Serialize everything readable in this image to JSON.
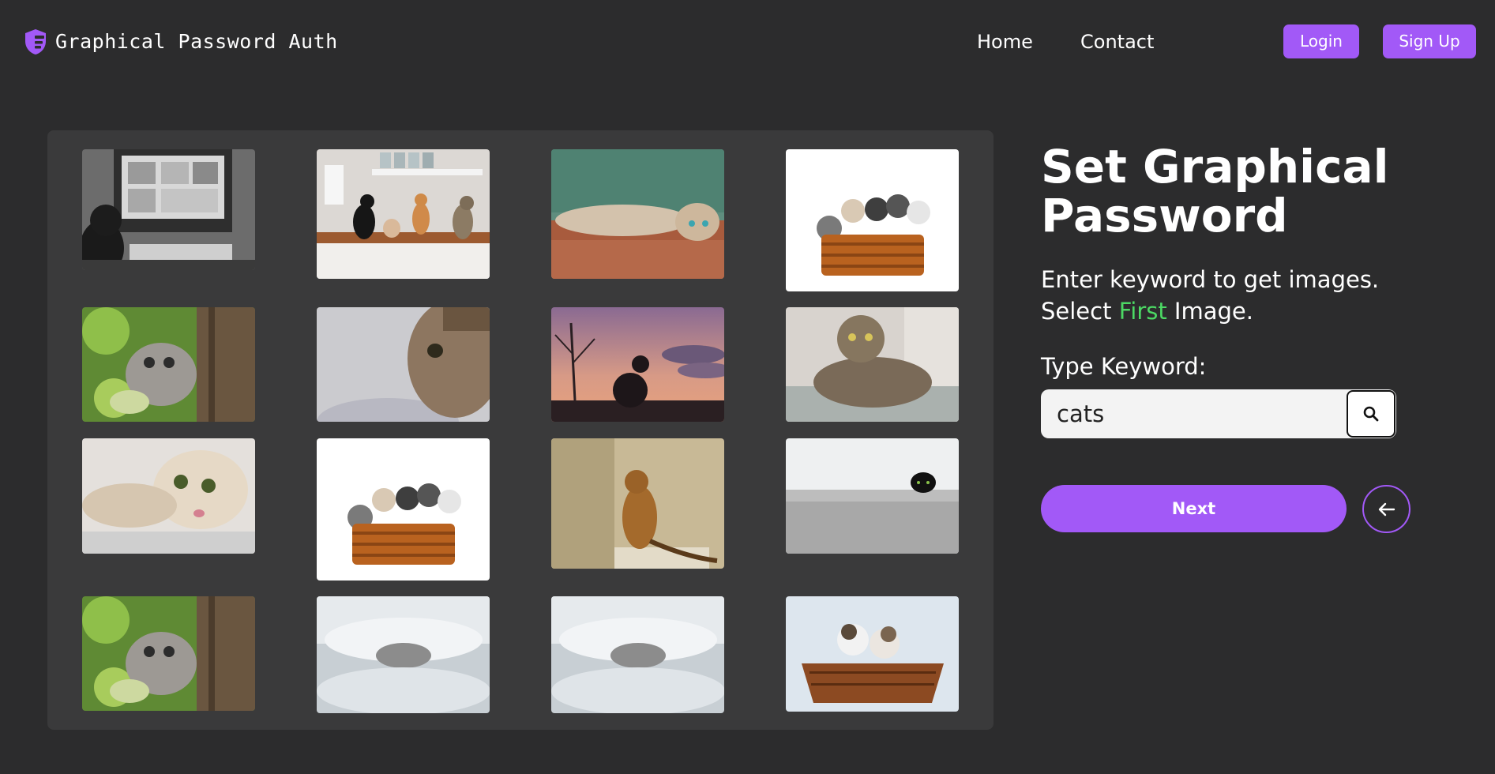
{
  "header": {
    "brand": "Graphical Password Auth",
    "brand_icon": "shield-key-icon",
    "nav_links": [
      "Home",
      "Contact"
    ],
    "login_label": "Login",
    "signup_label": "Sign Up"
  },
  "gallery": {
    "images": [
      {
        "description": "cat-in-front-of-computer"
      },
      {
        "description": "cats-on-kitchen-counter"
      },
      {
        "description": "cat-lying-on-wooden-floor"
      },
      {
        "description": "kittens-in-wicker-basket"
      },
      {
        "description": "kitten-peeking-behind-tree"
      },
      {
        "description": "cat-face-closeup"
      },
      {
        "description": "cat-silhouette-at-sunset"
      },
      {
        "description": "tabby-cat-on-sofa"
      },
      {
        "description": "surprised-cat-face"
      },
      {
        "description": "kittens-in-wicker-basket"
      },
      {
        "description": "bengal-cat-sitting"
      },
      {
        "description": "black-cat-behind-wall"
      },
      {
        "description": "kitten-peeking-behind-tree"
      },
      {
        "description": "kitten-under-blanket"
      },
      {
        "description": "kitten-under-blanket"
      },
      {
        "description": "two-kittens-in-basket"
      }
    ]
  },
  "panel": {
    "title": "Set Graphical Password",
    "instruction_line1": "Enter keyword to get images.",
    "instruction_select_prefix": "Select ",
    "instruction_highlight": "First",
    "instruction_suffix": " Image.",
    "keyword_label": "Type Keyword:",
    "keyword_value": "cats",
    "search_icon": "search-icon",
    "next_label": "Next",
    "back_icon": "arrow-left-icon"
  },
  "colors": {
    "background": "#2c2c2d",
    "card": "#3a3a3b",
    "accent": "#a259f7",
    "highlight": "#4cd964"
  }
}
